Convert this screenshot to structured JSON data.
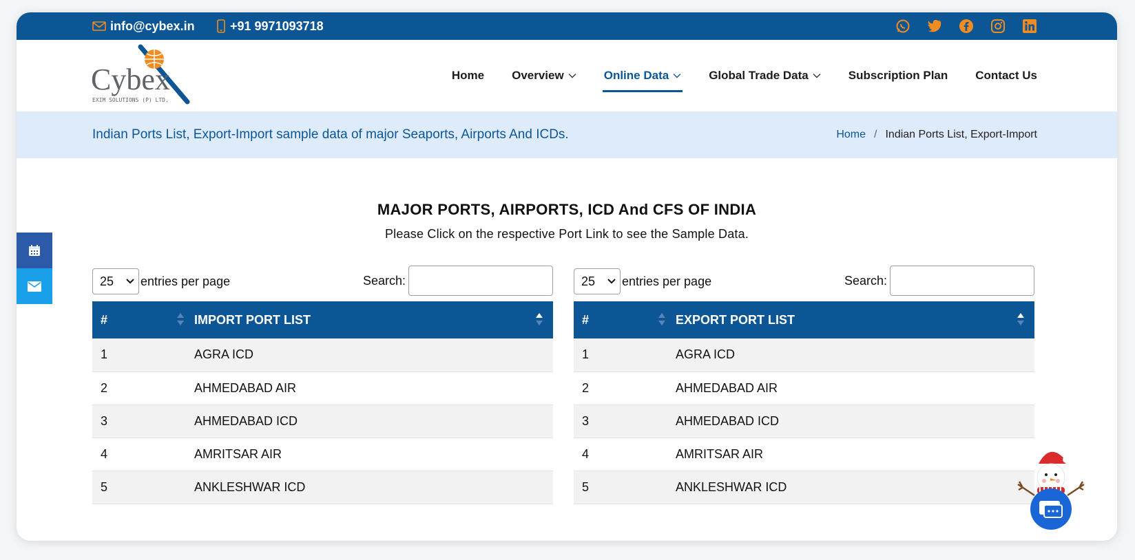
{
  "topbar": {
    "email": "info@cybex.in",
    "phone": "+91 9971093718",
    "social_icons": [
      "whatsapp-icon",
      "twitter-icon",
      "facebook-icon",
      "instagram-icon",
      "linkedin-icon"
    ],
    "icon_color": "#f28c1e",
    "bg_color": "#0c5696"
  },
  "header": {
    "logo_text": "Cybex",
    "logo_subtext": "EXIM SOLUTIONS (P) LTD.",
    "nav": [
      {
        "label": "Home",
        "dropdown": false,
        "active": false
      },
      {
        "label": "Overview",
        "dropdown": true,
        "active": false
      },
      {
        "label": "Online Data",
        "dropdown": true,
        "active": true
      },
      {
        "label": "Global Trade Data",
        "dropdown": true,
        "active": false
      },
      {
        "label": "Subscription Plan",
        "dropdown": false,
        "active": false
      },
      {
        "label": "Contact Us",
        "dropdown": false,
        "active": false
      }
    ]
  },
  "band": {
    "title": "Indian Ports List, Export-Import sample data of major Seaports, Airports And ICDs.",
    "breadcrumb_home": "Home",
    "breadcrumb_sep": "/",
    "breadcrumb_current": "Indian Ports List, Export-Import"
  },
  "main": {
    "heading": "MAJOR PORTS, AIRPORTS, ICD And CFS OF INDIA",
    "subheading": "Please Click on the respective Port Link to see the Sample Data."
  },
  "tables": {
    "import": {
      "page_size": "25",
      "entries_label": "entries per page",
      "search_label": "Search:",
      "search_value": "",
      "col_num": "#",
      "col_name": "IMPORT PORT LIST",
      "rows": [
        {
          "num": "1",
          "name": "AGRA ICD"
        },
        {
          "num": "2",
          "name": "AHMEDABAD AIR"
        },
        {
          "num": "3",
          "name": "AHMEDABAD ICD"
        },
        {
          "num": "4",
          "name": "AMRITSAR AIR"
        },
        {
          "num": "5",
          "name": "ANKLESHWAR ICD"
        }
      ]
    },
    "export": {
      "page_size": "25",
      "entries_label": "entries per page",
      "search_label": "Search:",
      "search_value": "",
      "col_num": "#",
      "col_name": "EXPORT PORT LIST",
      "rows": [
        {
          "num": "1",
          "name": "AGRA ICD"
        },
        {
          "num": "2",
          "name": "AHMEDABAD AIR"
        },
        {
          "num": "3",
          "name": "AHMEDABAD ICD"
        },
        {
          "num": "4",
          "name": "AMRITSAR AIR"
        },
        {
          "num": "5",
          "name": "ANKLESHWAR ICD"
        }
      ]
    }
  },
  "floating": {
    "buttons": [
      "calendar-icon",
      "mail-icon"
    ],
    "chat_icon": "chat-bubble-icon"
  }
}
